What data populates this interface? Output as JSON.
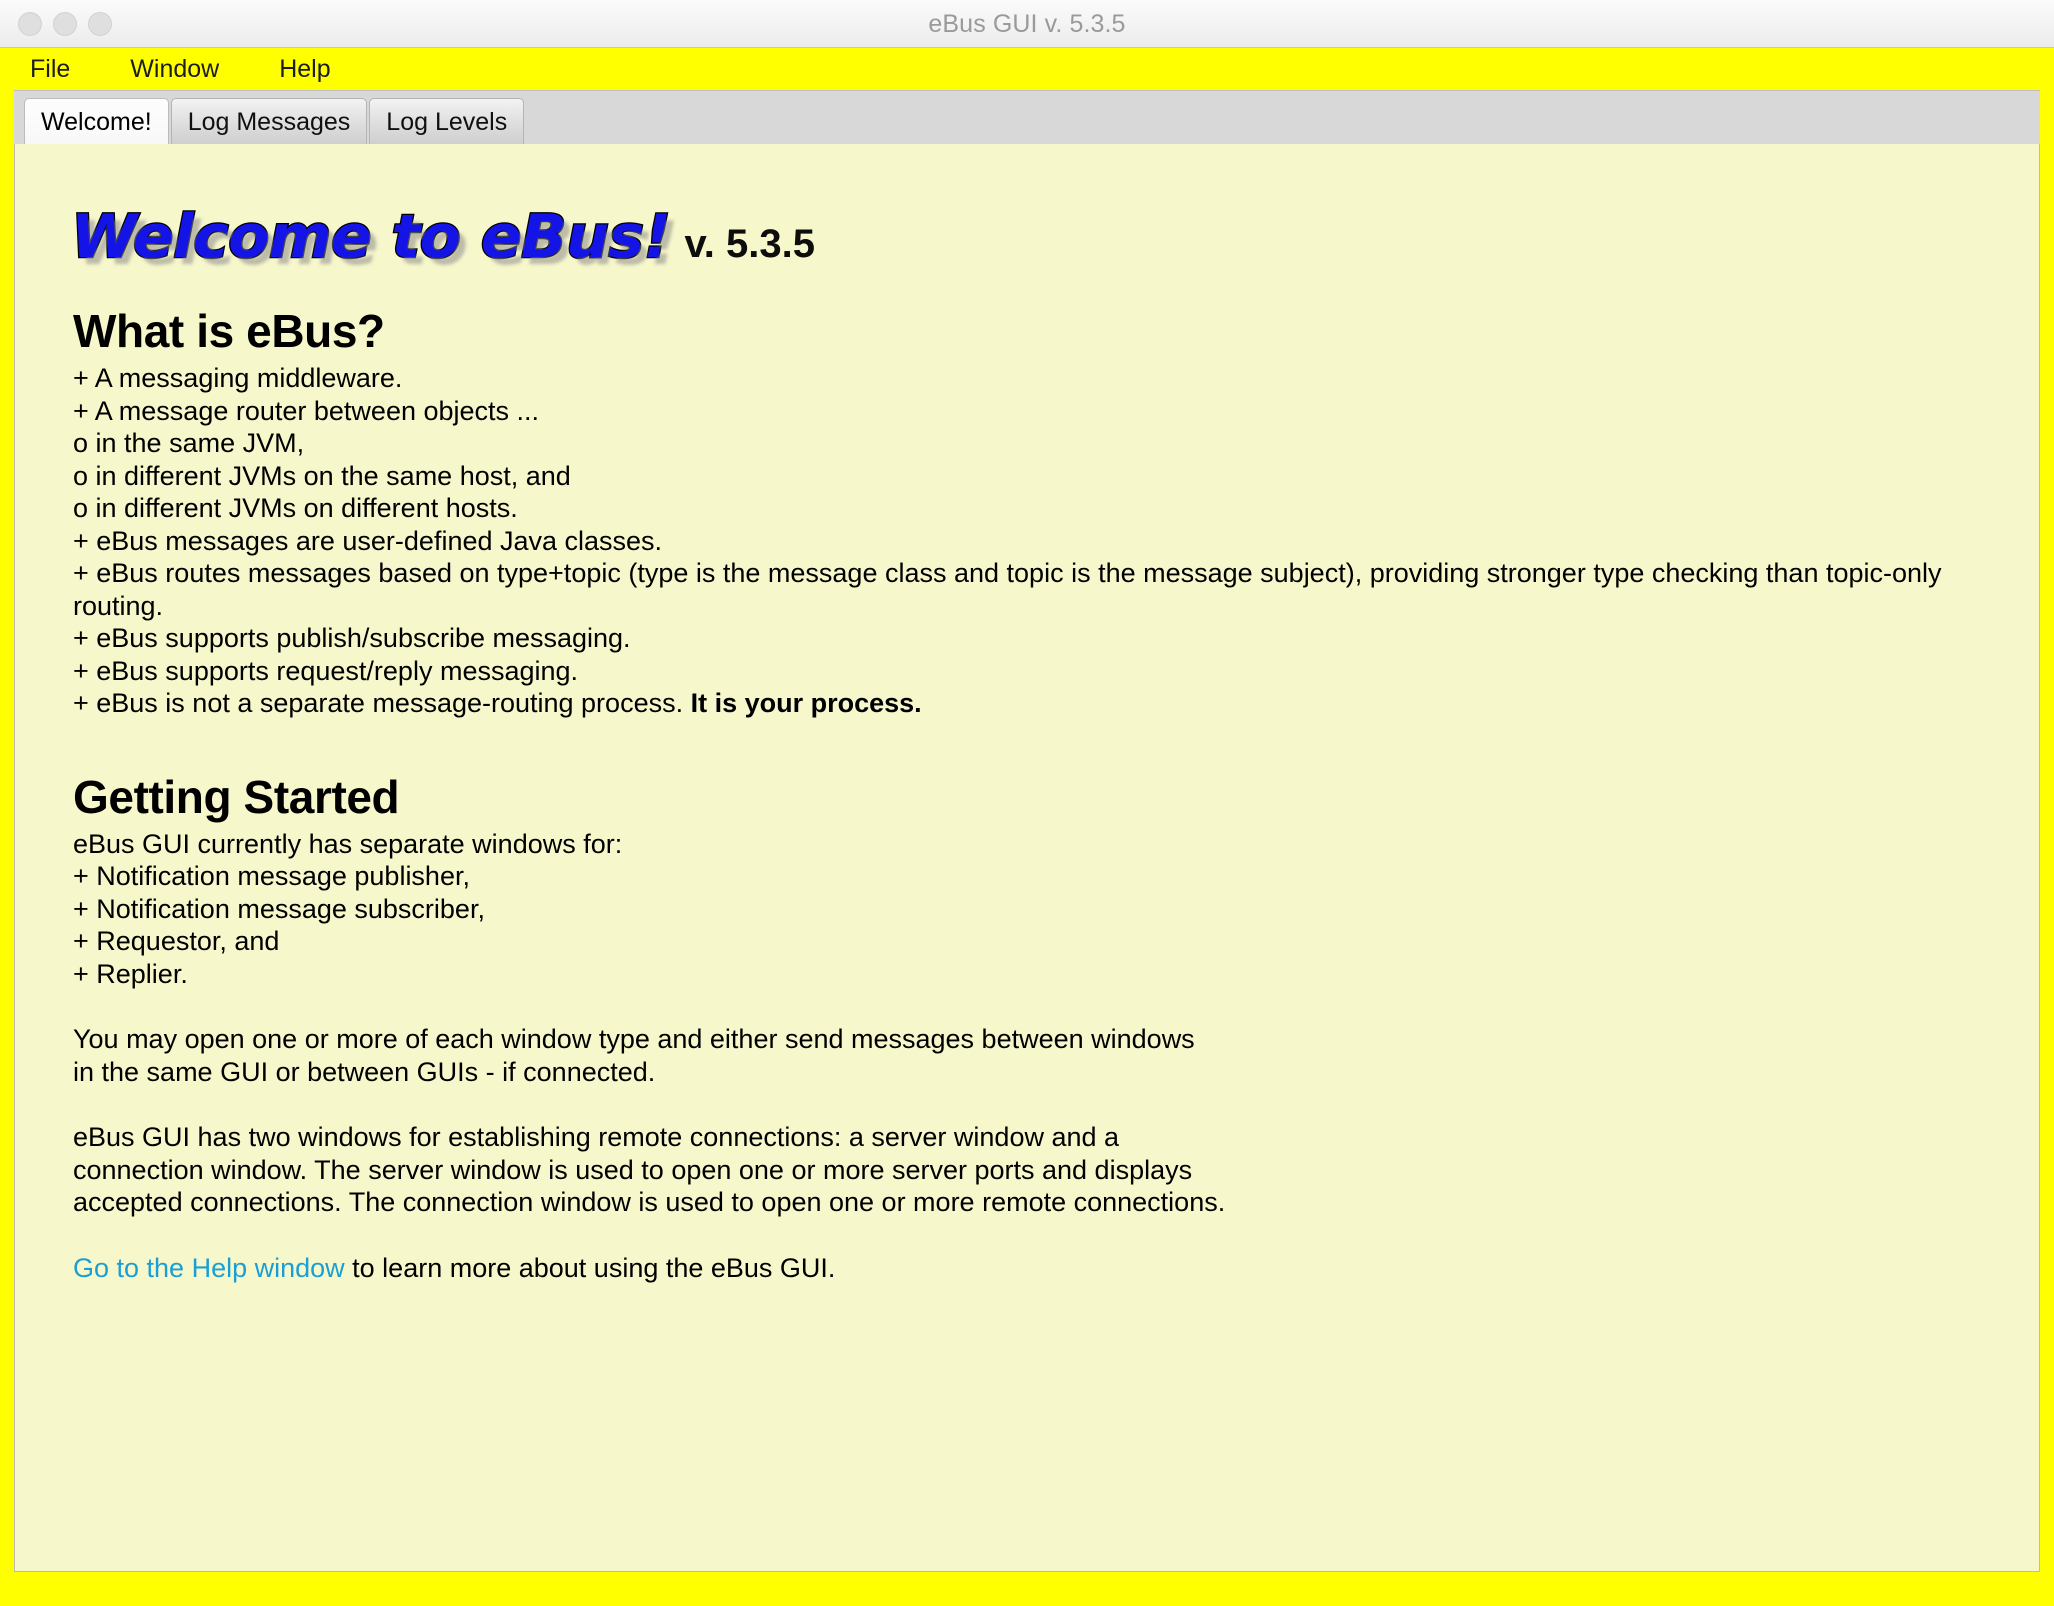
{
  "window": {
    "title": "eBus GUI v. 5.3.5",
    "traffic_lights": [
      "close",
      "minimize",
      "zoom"
    ],
    "colors": {
      "menubar": "#ffff00",
      "frame": "#ffff00",
      "content_bg": "#f7f7cc",
      "tabstrip_bg": "#d8d8d8",
      "link": "#1a9fd4",
      "logo_blue": "#1414e6"
    }
  },
  "menubar": {
    "items": [
      {
        "label": "File"
      },
      {
        "label": "Window"
      },
      {
        "label": "Help"
      }
    ]
  },
  "tabs": {
    "selected": "Welcome!",
    "items": [
      {
        "label": "Welcome!"
      },
      {
        "label": "Log Messages"
      },
      {
        "label": "Log Levels"
      }
    ]
  },
  "welcome": {
    "logo_text": "Welcome to eBus!",
    "version": "v. 5.3.5",
    "what_is": {
      "heading": "What is eBus?",
      "lines": [
        "+ A messaging middleware.",
        "+ A message router between objects ...",
        "o in the same JVM,",
        "o in different JVMs on the same host, and",
        "o in different JVMs on different hosts.",
        "+ eBus messages are user-defined Java classes.",
        "+ eBus routes messages based on type+topic (type is the message class and topic is the message subject), providing stronger type checking than topic-only routing.",
        "+ eBus supports publish/subscribe messaging.",
        "+ eBus supports request/reply messaging.",
        "+ eBus is not a separate message-routing process. ",
        "It is your process."
      ]
    },
    "getting_started": {
      "heading": "Getting Started",
      "intro": "eBus GUI currently has separate windows for:",
      "windows": [
        "+ Notification message publisher,",
        "+ Notification message subscriber,",
        "+ Requestor, and",
        "+ Replier."
      ],
      "paragraph1_line1": "You may open one or more of each window type and either send messages between windows",
      "paragraph1_line2": "in the same GUI or between GUIs - if connected.",
      "paragraph2_line1": "eBus GUI has two windows for establishing remote connections: a server window and a",
      "paragraph2_line2": "connection window. The server window is used to open one or more server ports and displays",
      "paragraph2_line3": "accepted connections. The connection window is used to open one or more remote connections.",
      "help_link": "Go to the Help window",
      "help_suffix": " to learn more about using the eBus GUI."
    }
  }
}
